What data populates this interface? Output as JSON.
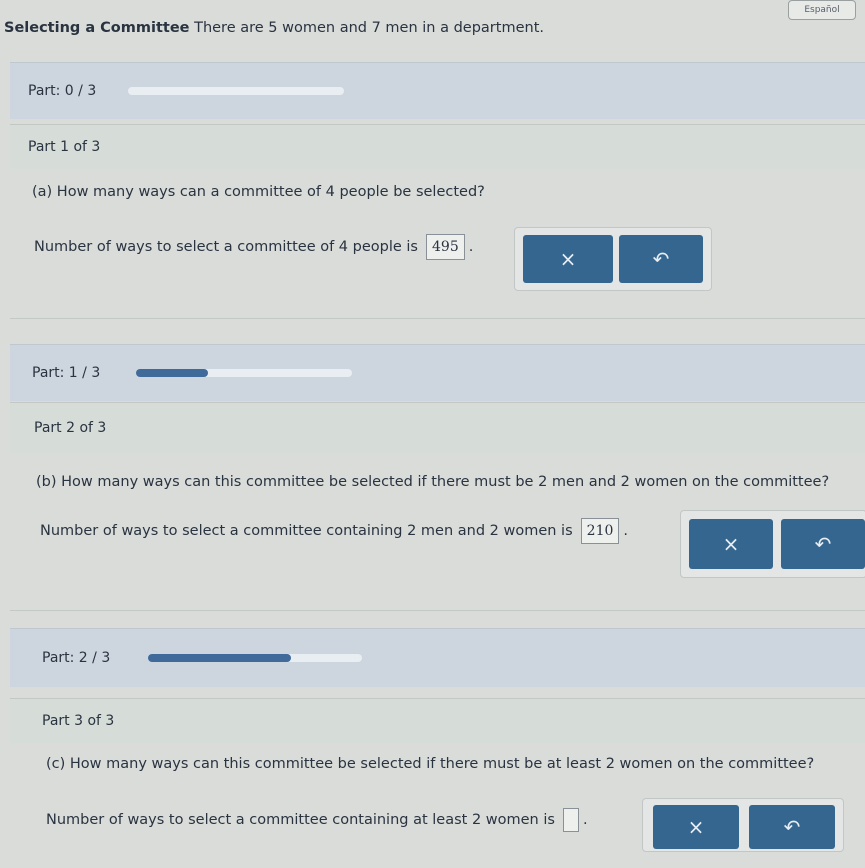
{
  "header": {
    "language_button": "Español",
    "problem_lead": "Selecting a Committee",
    "problem_text": "There are 5 women and 7 men in a department."
  },
  "parts": [
    {
      "progress_label": "Part: 0 / 3",
      "progress_fraction": 0.0,
      "part_title": "Part 1 of 3",
      "question": "(a) How many ways can a committee of 4 people be selected?",
      "answer_prefix": "Number of ways to select a committee of 4 people is",
      "answer_value": "495",
      "answer_suffix": "."
    },
    {
      "progress_label": "Part: 1 / 3",
      "progress_fraction": 0.333,
      "part_title": "Part 2 of 3",
      "question": "(b) How many ways can this committee be selected if there must be 2 men and 2 women on the committee?",
      "answer_prefix": "Number of ways to select a committee containing 2 men and 2 women is",
      "answer_value": "210",
      "answer_suffix": "."
    },
    {
      "progress_label": "Part: 2 / 3",
      "progress_fraction": 0.667,
      "part_title": "Part 3 of 3",
      "question": "(c) How many ways can this committee be selected if there must be at least 2 women on the committee?",
      "answer_prefix": "Number of ways to select a committee containing at least 2 women is",
      "answer_value": "",
      "answer_suffix": "."
    }
  ],
  "buttons": {
    "clear_glyph": "×",
    "undo_glyph": "↶"
  },
  "icons": {
    "clear": "close-icon",
    "undo": "undo-icon"
  }
}
